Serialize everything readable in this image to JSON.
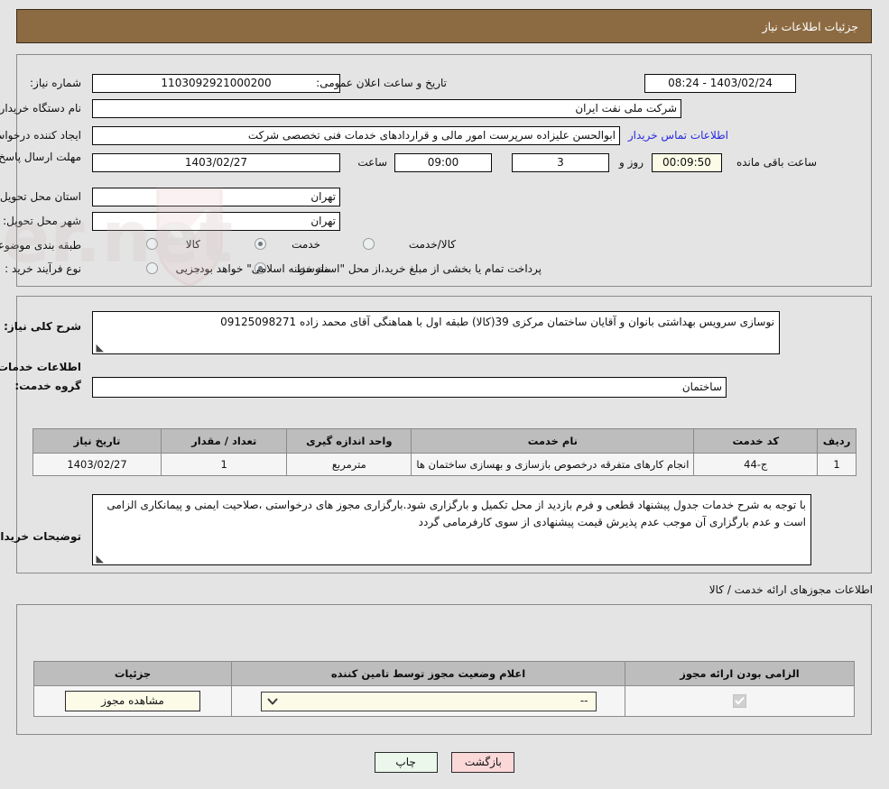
{
  "header": {
    "title": "جزئیات اطلاعات نیاز"
  },
  "watermark": {
    "text": "AriaTender.net"
  },
  "form": {
    "need_number_label": "شماره نیاز:",
    "need_number_value": "1103092921000200",
    "public_announce_label": "تاریخ و ساعت اعلان عمومی:",
    "public_announce_value": "1403/02/24 - 08:24",
    "buyer_org_label": "نام دستگاه خریدار:",
    "buyer_org_value": "شرکت ملی نفت ایران",
    "creator_label": "ایجاد کننده درخواست:",
    "creator_value": "ابوالحسن علیزاده سرپرست امور مالی و قراردادهای خدمات فنی تخصصی شرکت",
    "contact_link": "اطلاعات تماس خریدار",
    "deadline_label": "مهلت ارسال پاسخ: تا تاریخ:",
    "deadline_date": "1403/02/27",
    "hour_label": "ساعت",
    "deadline_time": "09:00",
    "days_value": "3",
    "days_label": "روز و",
    "countdown_value": "00:09:50",
    "countdown_label": "ساعت باقی مانده",
    "province_label": "استان محل تحویل:",
    "province_value": "تهران",
    "city_label": "شهر محل تحویل:",
    "city_value": "تهران",
    "category_label": "طبقه بندی موضوعی:",
    "category_options": [
      {
        "label": "کالا",
        "selected": false
      },
      {
        "label": "خدمت",
        "selected": true
      },
      {
        "label": "کالا/خدمت",
        "selected": false
      }
    ],
    "purchase_type_label": "نوع فرآیند خرید :",
    "purchase_type_options": [
      {
        "label": "جزیی",
        "selected": false
      },
      {
        "label": "متوسط",
        "selected": true
      }
    ],
    "payment_note": "پرداخت تمام یا بخشی از مبلغ خرید،از محل \"اسناد خزانه اسلامی\" خواهد بود."
  },
  "general_description": {
    "label": "شرح کلی نیاز:",
    "value": "نوسازی سرویس بهداشتی بانوان و آقایان ساختمان مرکزی 39(کالا) طبقه اول با هماهنگی آقای محمد زاده 09125098271"
  },
  "services_section": {
    "caption": "اطلاعات خدمات مورد نیاز",
    "group_label": "گروه خدمت:",
    "group_value": "ساختمان",
    "columns": [
      "ردیف",
      "کد خدمت",
      "نام خدمت",
      "واحد اندازه گیری",
      "تعداد / مقدار",
      "تاریخ نیاز"
    ],
    "rows": [
      {
        "row_no": "1",
        "service_code": "ج-44",
        "service_name": "انجام کارهای متفرقه درخصوص بازسازی و بهسازی ساختمان ها",
        "unit": "مترمربع",
        "quantity": "1",
        "need_date": "1403/02/27"
      }
    ]
  },
  "buyer_notes": {
    "label": "توضیحات خریدار:",
    "value": "با توجه به شرح خدمات جدول پیشنهاد قطعی و فرم بازدید از محل تکمیل و بارگزاری شود.بارگزاری مجوز های درخواستی ،صلاحیت ایمنی و پیمانکاری الزامی است و عدم بارگزاری آن موجب عدم پذیرش قیمت پیشنهادی  از سوی کارفرمامی گردد"
  },
  "permits_section": {
    "caption": "اطلاعات مجوزهای ارائه خدمت / کالا",
    "columns": [
      "الزامی بودن ارائه مجوز",
      "اعلام وضعیت مجوز توسط تامین کننده",
      "جزئیات"
    ],
    "rows": [
      {
        "required": true,
        "status_value": "--",
        "details_button": "مشاهده مجوز"
      }
    ]
  },
  "footer": {
    "print_label": "چاپ",
    "back_label": "بازگشت"
  }
}
